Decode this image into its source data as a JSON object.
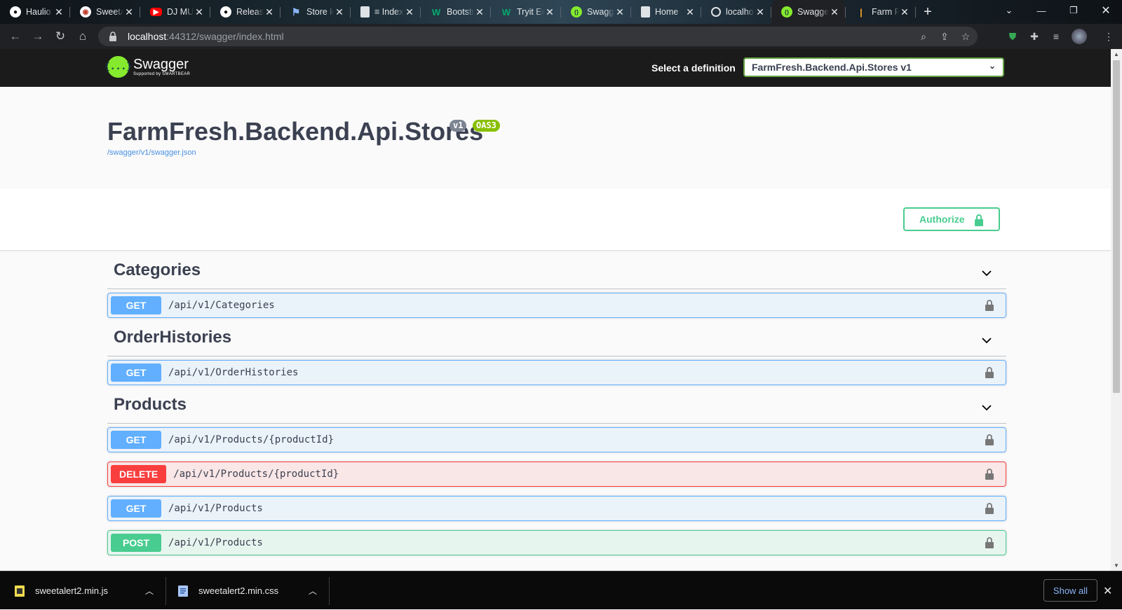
{
  "browser": {
    "tabs": [
      {
        "title": "Haulio",
        "favicon": "github-icon",
        "active": false
      },
      {
        "title": "SweetAlert",
        "favicon": "sweetalert-icon",
        "active": false
      },
      {
        "title": "DJ MUSIC",
        "favicon": "youtube-icon",
        "active": false
      },
      {
        "title": "Releases",
        "favicon": "github-icon",
        "active": false
      },
      {
        "title": "Store locator",
        "favicon": "flag-icon",
        "active": false
      },
      {
        "title": "≡ Index",
        "favicon": "document-icon",
        "active": false
      },
      {
        "title": "Bootstrap",
        "favicon": "w3-icon",
        "active": false
      },
      {
        "title": "Tryit Editor",
        "favicon": "w3-icon",
        "active": false
      },
      {
        "title": "Swagger UI",
        "favicon": "swagger-icon",
        "active": false
      },
      {
        "title": "Home",
        "favicon": "document-icon",
        "active": false
      },
      {
        "title": "localhost",
        "favicon": "globe-icon",
        "active": false
      },
      {
        "title": "Swagger UI",
        "favicon": "swagger-icon",
        "active": true
      },
      {
        "title": "Farm Fresh",
        "favicon": "farm-icon",
        "active": false
      }
    ],
    "url_host": "localhost",
    "url_rest": ":44312/swagger/index.html"
  },
  "topbar": {
    "logo_text": "Swagger",
    "logo_sub": "Supported by SMARTBEAR",
    "logo_glyph": "{...}",
    "select_label": "Select a definition",
    "selected_definition": "FarmFresh.Backend.Api.Stores v1"
  },
  "info": {
    "title": "FarmFresh.Backend.Api.Stores",
    "version_badge": "v1",
    "oas_badge": "OAS3",
    "spec_link": "/swagger/v1/swagger.json"
  },
  "auth": {
    "label": "Authorize"
  },
  "tags": [
    {
      "name": "Categories",
      "ops": [
        {
          "method": "GET",
          "path": "/api/v1/Categories"
        }
      ]
    },
    {
      "name": "OrderHistories",
      "ops": [
        {
          "method": "GET",
          "path": "/api/v1/OrderHistories"
        }
      ]
    },
    {
      "name": "Products",
      "ops": [
        {
          "method": "GET",
          "path": "/api/v1/Products/{productId}"
        },
        {
          "method": "DELETE",
          "path": "/api/v1/Products/{productId}"
        },
        {
          "method": "GET",
          "path": "/api/v1/Products"
        },
        {
          "method": "POST",
          "path": "/api/v1/Products"
        }
      ]
    }
  ],
  "downloads": {
    "files": [
      "sweetalert2.min.js",
      "sweetalert2.min.css"
    ],
    "show_all": "Show all"
  },
  "colors": {
    "get": "#61affe",
    "delete": "#f93e3e",
    "post": "#49cc90",
    "swagger_green": "#85ea2d"
  }
}
